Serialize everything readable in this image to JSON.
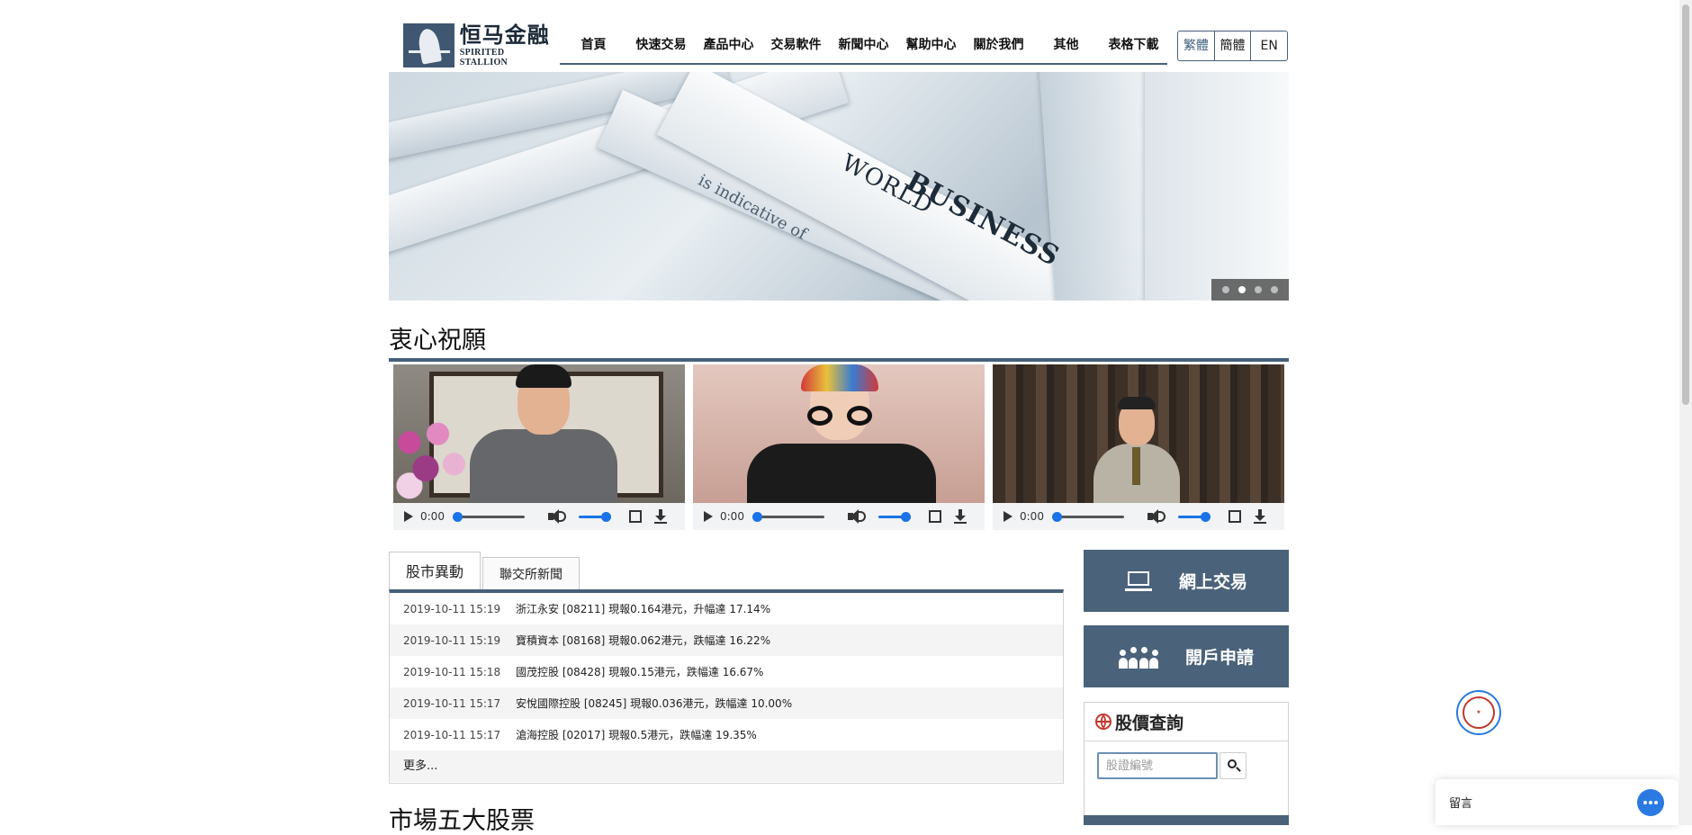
{
  "logo": {
    "cn": "恒马金融",
    "en": "SPIRITED STALLION"
  },
  "nav": {
    "items": [
      "首頁",
      "快速交易",
      "產品中心",
      "交易軟件",
      "新聞中心",
      "幫助中心",
      "關於我們",
      "其他",
      "表格下載"
    ]
  },
  "lang": {
    "items": [
      "繁體",
      "簡體",
      "EN"
    ],
    "active": "繁體"
  },
  "banner": {
    "text_top": "WORLD",
    "text_main": "BUSINESS",
    "text_small": "is indicative of",
    "slides": 4,
    "active_slide": 2
  },
  "section_wishes": {
    "title": "衷心祝願"
  },
  "videos": [
    {
      "time": "0:00"
    },
    {
      "time": "0:00"
    },
    {
      "time": "0:00"
    }
  ],
  "news": {
    "tabs": [
      "股市異動",
      "聯交所新聞"
    ],
    "active_tab": "股市異動",
    "rows": [
      {
        "time": "2019-10-11 15:19",
        "text": "浙江永安 [08211] 現報0.164港元，升幅達 17.14%"
      },
      {
        "time": "2019-10-11 15:19",
        "text": "寶積資本 [08168] 現報0.062港元，跌幅達 16.22%"
      },
      {
        "time": "2019-10-11 15:18",
        "text": "國茂控股 [08428] 現報0.15港元，跌幅達 16.67%"
      },
      {
        "time": "2019-10-11 15:17",
        "text": "安悅國際控股 [08245] 現報0.036港元，跌幅達 10.00%"
      },
      {
        "time": "2019-10-11 15:17",
        "text": "滄海控股 [02017] 現報0.5港元，跌幅達 19.35%"
      }
    ],
    "more": "更多..."
  },
  "section_top5": {
    "title": "市場五大股票"
  },
  "actions": {
    "online_trading": "網上交易",
    "open_account": "開戶申請"
  },
  "quote": {
    "title": "股價查詢",
    "placeholder": "股證編號"
  },
  "chat": {
    "label": "留言"
  },
  "colors": {
    "primary": "#4a627a",
    "accent": "#2a7ae2",
    "lang_active": "#41607e"
  }
}
